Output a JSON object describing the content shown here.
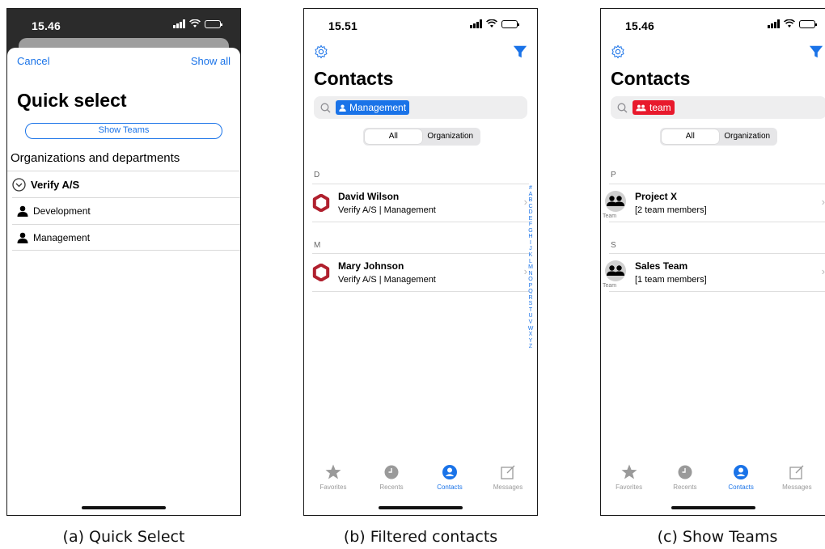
{
  "panels": [
    {
      "caption": "(a) Quick Select",
      "time": "15.46",
      "cancel": "Cancel",
      "show_all": "Show all",
      "title": "Quick select",
      "show_teams": "Show Teams",
      "section": "Organizations and departments",
      "org": "Verify A/S",
      "departments": [
        "Development",
        "Management"
      ]
    },
    {
      "caption": "(b) Filtered contacts",
      "time": "15.51",
      "title": "Contacts",
      "search_token": "Management",
      "token_color": "#1a73e8",
      "segments": [
        "All",
        "Organization"
      ],
      "groups": [
        {
          "letter": "D",
          "name": "David Wilson",
          "detail": "Verify A/S | Management"
        },
        {
          "letter": "M",
          "name": "Mary Johnson",
          "detail": "Verify A/S | Management"
        }
      ],
      "index_letters": [
        "#",
        "A",
        "B",
        "C",
        "D",
        "E",
        "F",
        "G",
        "H",
        "I",
        "J",
        "K",
        "L",
        "M",
        "N",
        "O",
        "P",
        "Q",
        "R",
        "S",
        "T",
        "U",
        "V",
        "W",
        "X",
        "Y",
        "Z"
      ],
      "tabs": [
        "Favorites",
        "Recents",
        "Contacts",
        "Messages"
      ],
      "active_tab": "Contacts"
    },
    {
      "caption": "(c) Show Teams",
      "time": "15.46",
      "title": "Contacts",
      "search_token": "team",
      "token_color": "#e8192c",
      "segments": [
        "All",
        "Organization"
      ],
      "groups": [
        {
          "letter": "P",
          "name": "Project X",
          "detail": "[2 team members]",
          "badge": "Team"
        },
        {
          "letter": "S",
          "name": "Sales Team",
          "detail": "[1 team members]",
          "badge": "Team"
        }
      ],
      "tabs": [
        "Favorites",
        "Recents",
        "Contacts",
        "Messages"
      ],
      "active_tab": "Contacts"
    }
  ],
  "colors": {
    "accent": "#1a73e8",
    "team_token": "#e8192c",
    "contact_ring": "#b0202e"
  }
}
